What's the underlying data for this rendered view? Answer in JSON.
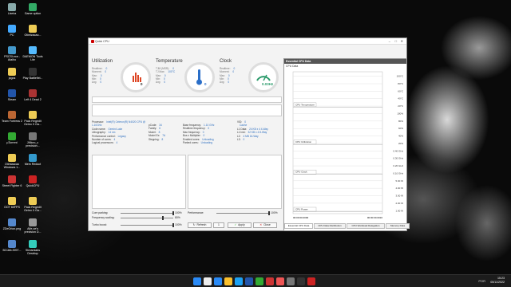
{
  "desktop": {
    "icons": [
      {
        "label": "Lixeira",
        "color": "#8aa"
      },
      {
        "label": "Game option",
        "color": "#3a6"
      },
      {
        "label": "PC",
        "color": "#4af"
      },
      {
        "label": "Otimizacao...",
        "color": "#ec5"
      },
      {
        "label": "PSCSI.exe - Atalho",
        "color": "#49c"
      },
      {
        "label": "DAEMON Tools Lite",
        "color": "#5bf"
      },
      {
        "label": "jogos",
        "color": "#ec5"
      },
      {
        "label": "Play Battlefiel...",
        "color": "#333"
      },
      {
        "label": "Steam",
        "color": "#25a"
      },
      {
        "label": "Left 4 Dead 2",
        "color": "#a33"
      },
      {
        "label": "Team Fortress 2",
        "color": "#b63"
      },
      {
        "label": "Pack Regedit Geleo X Ga...",
        "color": "#ec5"
      },
      {
        "label": "µTorrent",
        "color": "#3a3"
      },
      {
        "label": "JMicro_c precision...",
        "color": "#777"
      },
      {
        "label": "Otimizacao Windows 1...",
        "color": "#ec5"
      },
      {
        "label": "Mem Reduct",
        "color": "#39c"
      },
      {
        "label": "Street Fighter 6",
        "color": "#c33"
      },
      {
        "label": "QuickCPU",
        "color": "#c22"
      },
      {
        "label": "OOT 60FPS",
        "color": "#ec5"
      },
      {
        "label": "Pack Regedit Geleo X Ga...",
        "color": "#ec5"
      },
      {
        "label": "ZDeOrion.png",
        "color": "#58c"
      },
      {
        "label": "Alfe.oe's precision D...",
        "color": "#999"
      },
      {
        "label": "BOJdb.3997...",
        "color": "#58c"
      },
      {
        "label": "Streamlabs Desktop",
        "color": "#3cb"
      }
    ]
  },
  "window": {
    "title": "Quick CPU",
    "controls": {
      "min": "–",
      "max": "□",
      "close": "✕"
    }
  },
  "utilization": {
    "title": "Utilization",
    "rows": [
      {
        "k": "Realtime:",
        "v": "0"
      },
      {
        "k": "Moment:",
        "v": "0"
      },
      {
        "k": "Max:",
        "v": "0"
      },
      {
        "k": "Min:",
        "v": "0"
      },
      {
        "k": "Avg:",
        "v": "0"
      }
    ],
    "gauge_value": "0"
  },
  "temperature": {
    "title": "Temperature",
    "rows": [
      {
        "k": "TJM (MSR):",
        "v": "0"
      },
      {
        "k": "TJ Max:",
        "v": "100°C"
      },
      {
        "k": "Max:",
        "v": "0"
      },
      {
        "k": "Min:",
        "v": "0"
      },
      {
        "k": "Avg:",
        "v": "0"
      }
    ],
    "gauge_value": "0"
  },
  "clock": {
    "title": "Clock",
    "rows": [
      {
        "k": "Realtime:",
        "v": "0"
      },
      {
        "k": "Moment:",
        "v": "0"
      },
      {
        "k": "Max:",
        "v": "0"
      },
      {
        "k": "Min:",
        "v": "0"
      },
      {
        "k": "Avg:",
        "v": "0"
      }
    ],
    "gauge_value": "0.03Hz"
  },
  "processor": {
    "rows_left": [
      {
        "k": "Processor:",
        "v": "Intel(R) Celeron(R) N4020 CPU @ 1.10GHz"
      },
      {
        "k": "Code name:",
        "v": "Gemini Lake"
      },
      {
        "k": "Lithography:",
        "v": "14 nm"
      },
      {
        "k": "Performance control:",
        "v": "Legacy"
      },
      {
        "k": "Number of cores:",
        "v": "4"
      },
      {
        "k": "Logical processors:",
        "v": "4"
      }
    ],
    "rows_mid": [
      {
        "k": "pCode:",
        "v": "34"
      },
      {
        "k": "Family:",
        "v": "6"
      },
      {
        "k": "Model:",
        "v": "8"
      },
      {
        "k": "Model Ex:",
        "v": "7A"
      },
      {
        "k": "Stepping:",
        "v": "8"
      }
    ],
    "rows_mid2": [
      {
        "k": "Base frequency:",
        "v": "1.10 GHz"
      },
      {
        "k": "Realtime frequency:",
        "v": "0"
      },
      {
        "k": "Max frequency:",
        "v": "0"
      },
      {
        "k": "Bus x Multiplier:",
        "v": "0"
      },
      {
        "k": "Enabled cores:",
        "v": "Unloading"
      },
      {
        "k": "Parked cores:",
        "v": "Unloading"
      }
    ],
    "rows_right": [
      {
        "k": "VID:",
        "v": "0"
      },
      {
        "k": "",
        "v": "Cache"
      },
      {
        "k": "L1 Data:",
        "v": "24 KB x 4 4-Way"
      },
      {
        "k": "L1 Inst:",
        "v": "32 KB x 4 8-Way"
      },
      {
        "k": "L2:",
        "v": "4 MB 16-Way"
      },
      {
        "k": "L3:",
        "v": "0"
      }
    ]
  },
  "controls": {
    "core_parking": {
      "label": "Core parking:",
      "value": 100,
      "pct": "100%"
    },
    "frequency_scaling": {
      "label": "Frequency scaling:",
      "value": 80,
      "pct": "80%"
    },
    "turbo_boost": {
      "label": "Turbo boost:",
      "value": 100,
      "pct": "100%"
    },
    "performance": {
      "label": "Performance:",
      "value": 100,
      "pct": "100%"
    },
    "refresh_label": "Refresh",
    "refresh_value": "1",
    "apply_label": "Apply",
    "close_label": "Close"
  },
  "essential": {
    "header": "Essential CPU Data",
    "sub": "CPU Data",
    "series": [
      "CPU Temperature",
      "CPU Utilization",
      "CPU Clock",
      "CPU Power"
    ],
    "y_labels": [
      "100°C",
      "80°C",
      "60°C",
      "40°C",
      "20°C",
      "100%",
      "80%",
      "60%",
      "40%",
      "20%",
      "0.40 GHz",
      "0.30 GHz",
      "0.20 GHz",
      "0.10 GHz",
      "5.00 W",
      "4.00 W",
      "3.00 W",
      "2.00 W",
      "1.00 W"
    ],
    "x_start": "00:00:00.0000",
    "x_end": "00:00:00.0010",
    "tabs": [
      "Essential CPU Data",
      "CPU Data Distribution",
      "CPU Workload Delegation",
      "Memory Data"
    ]
  },
  "taskbar": {
    "time": "15:23",
    "date": "05/11/2022",
    "lang": "POR",
    "icons": [
      "#2a8af6",
      "#eee",
      "#2a8af6",
      "#fbc02d",
      "#1da1f2",
      "#25a",
      "#3a3",
      "#c33",
      "#e55",
      "#777",
      "#333",
      "#c22"
    ]
  }
}
